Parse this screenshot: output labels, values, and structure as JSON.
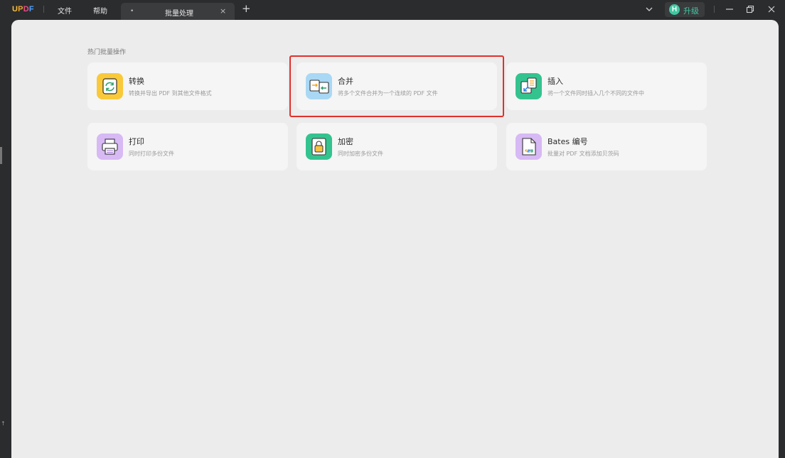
{
  "titlebar": {
    "logo_letters": [
      "U",
      "P",
      "D",
      "F"
    ],
    "logo_colors": [
      "#f6c342",
      "#f5a623",
      "#e94c8b",
      "#4da3ff"
    ],
    "menu": {
      "file": "文件",
      "help": "帮助"
    },
    "tab": {
      "marker": "•",
      "title": "批量处理",
      "close": "×"
    },
    "new_tab": "+",
    "upgrade": {
      "avatar_letter": "H",
      "label": "升级"
    }
  },
  "main": {
    "section_title": "热门批量操作",
    "side_mark": "↑",
    "cards": [
      {
        "title": "转换",
        "desc": "转换并导出 PDF 到其他文件格式",
        "icon": "convert-icon",
        "color": "#f9c93a"
      },
      {
        "title": "合并",
        "desc": "将多个文件合并为一个连续的 PDF 文件",
        "icon": "merge-icon",
        "color": "#a9d8f5"
      },
      {
        "title": "插入",
        "desc": "将一个文件同时插入几个不同的文件中",
        "icon": "insert-icon",
        "color": "#34c38f"
      },
      {
        "title": "打印",
        "desc": "同时打印多份文件",
        "icon": "print-icon",
        "color": "#d7b9f4"
      },
      {
        "title": "加密",
        "desc": "同时加密多份文件",
        "icon": "encrypt-icon",
        "color": "#34c38f"
      },
      {
        "title": "Bates 编号",
        "desc": "批量对 PDF 文档添加贝茨码",
        "icon": "bates-icon",
        "color": "#d7b9f4"
      }
    ]
  },
  "highlight_color": "#e1302b"
}
